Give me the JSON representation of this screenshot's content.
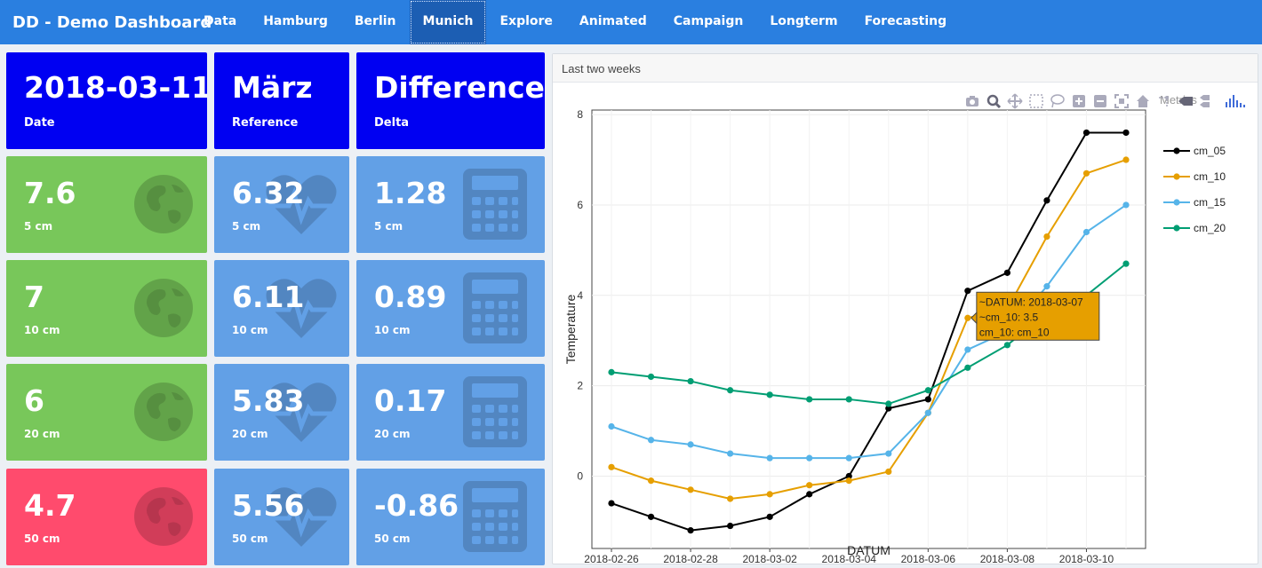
{
  "navbar": {
    "brand": "DD - Demo Dashboard",
    "tabs": [
      {
        "label": "Data"
      },
      {
        "label": "Hamburg"
      },
      {
        "label": "Berlin"
      },
      {
        "label": "Munich",
        "active": true
      },
      {
        "label": "Explore"
      },
      {
        "label": "Animated"
      },
      {
        "label": "Campaign"
      },
      {
        "label": "Longterm"
      },
      {
        "label": "Forecasting"
      }
    ]
  },
  "header_tiles": {
    "date": {
      "value": "2018-03-11",
      "label": "Date"
    },
    "reference": {
      "value": "März",
      "label": "Reference"
    },
    "difference": {
      "value": "Difference",
      "label": "Delta"
    }
  },
  "rows": [
    {
      "current": "7.6",
      "reference": "6.32",
      "delta": "1.28",
      "depth": "5 cm",
      "current_color": "green"
    },
    {
      "current": "7",
      "reference": "6.11",
      "delta": "0.89",
      "depth": "10 cm",
      "current_color": "green"
    },
    {
      "current": "6",
      "reference": "5.83",
      "delta": "0.17",
      "depth": "20 cm",
      "current_color": "green"
    },
    {
      "current": "4.7",
      "reference": "5.56",
      "delta": "-0.86",
      "depth": "50 cm",
      "current_color": "red"
    }
  ],
  "icons": {
    "current": "globe-icon",
    "reference": "heartbeat-icon",
    "delta": "calculator-icon"
  },
  "colors": {
    "nav": "#2a7fe0",
    "nav_active": "#1c5eb3",
    "dark_blue": "#0000f2",
    "green": "#78c75a",
    "light_blue": "#62a0e6",
    "red": "#ff4b6d"
  },
  "panel": {
    "title": "Last two weeks",
    "modebar_label": "Metrics"
  },
  "tooltip": {
    "line1": "~DATUM: 2018-03-07",
    "line2": "~cm_10:  3.5",
    "line3": "cm_10: cm_10"
  },
  "chart_data": {
    "type": "line",
    "xlabel": "DATUM",
    "ylabel": "Temperature",
    "x": [
      "2018-02-26",
      "2018-02-27",
      "2018-02-28",
      "2018-03-01",
      "2018-03-02",
      "2018-03-03",
      "2018-03-04",
      "2018-03-05",
      "2018-03-06",
      "2018-03-07",
      "2018-03-08",
      "2018-03-09",
      "2018-03-10",
      "2018-03-11"
    ],
    "x_ticks": [
      "2018-02-26",
      "2018-02-28",
      "2018-03-02",
      "2018-03-04",
      "2018-03-06",
      "2018-03-08",
      "2018-03-10"
    ],
    "y_ticks": [
      0,
      2,
      4,
      6,
      8
    ],
    "ylim": [
      -1.6,
      8.1
    ],
    "grid": true,
    "legend_position": "right",
    "series": [
      {
        "name": "cm_05",
        "color": "#000000",
        "values": [
          -0.6,
          -0.9,
          -1.2,
          -1.1,
          -0.9,
          -0.4,
          0.0,
          1.5,
          1.7,
          4.1,
          4.5,
          6.1,
          7.6,
          7.6
        ]
      },
      {
        "name": "cm_10",
        "color": "#e69f00",
        "values": [
          0.2,
          -0.1,
          -0.3,
          -0.5,
          -0.4,
          -0.2,
          -0.1,
          0.1,
          1.4,
          3.5,
          3.7,
          5.3,
          6.7,
          7.0
        ]
      },
      {
        "name": "cm_15",
        "color": "#56b4e9",
        "values": [
          1.1,
          0.8,
          0.7,
          0.5,
          0.4,
          0.4,
          0.4,
          0.5,
          1.4,
          2.8,
          3.2,
          4.2,
          5.4,
          6.0
        ]
      },
      {
        "name": "cm_20",
        "color": "#009e73",
        "values": [
          2.3,
          2.2,
          2.1,
          1.9,
          1.8,
          1.7,
          1.7,
          1.6,
          1.9,
          2.4,
          2.9,
          3.6,
          4.0,
          4.7
        ]
      }
    ]
  }
}
